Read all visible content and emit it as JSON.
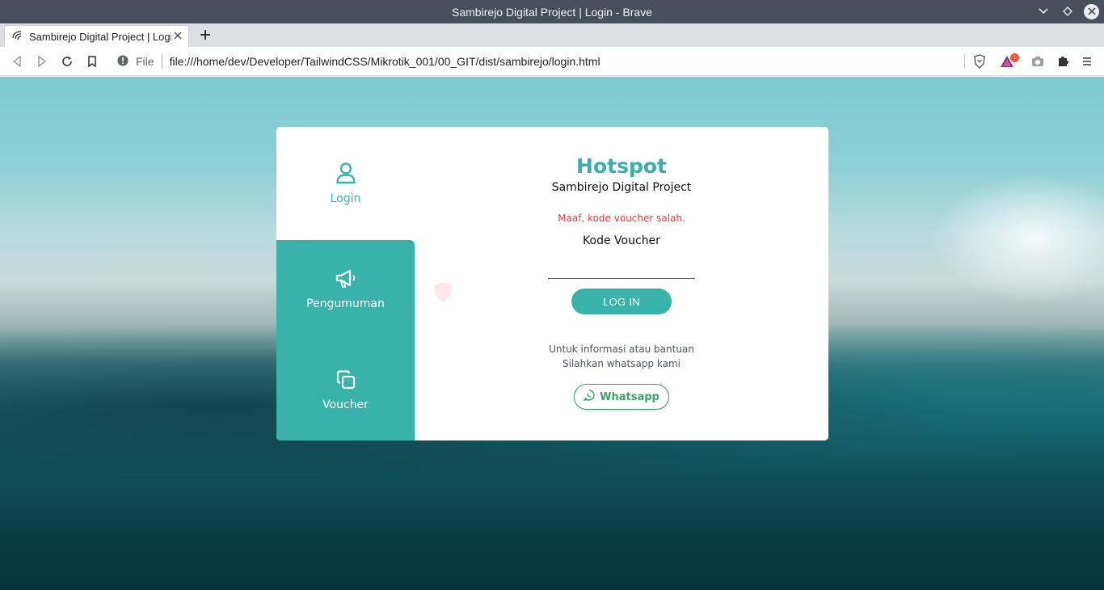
{
  "window": {
    "title": "Sambirejo Digital Project | Login - Brave"
  },
  "tab": {
    "title": "Sambirejo Digital Project | Login"
  },
  "addressbar": {
    "scheme_label": "File",
    "url": "file:///home/dev/Developer/TailwindCSS/Mikrotik_001/00_GIT/dist/sambirejo/login.html"
  },
  "extensions": {
    "rewards_badge": "1"
  },
  "sidebar": {
    "items": [
      {
        "label": "Login",
        "icon": "user-icon"
      },
      {
        "label": "Pengumuman",
        "icon": "megaphone-icon"
      },
      {
        "label": "Voucher",
        "icon": "copy-icon"
      }
    ]
  },
  "login": {
    "title": "Hotspot",
    "subtitle": "Sambirejo Digital Project",
    "error": "Maaf, kode voucher salah.",
    "voucher_label": "Kode Voucher",
    "voucher_value": "",
    "submit_label": "LOG IN",
    "info_line1": "Untuk informasi atau bantuan",
    "info_line2": "Silahkan whatsapp kami",
    "whatsapp_label": "Whatsapp"
  },
  "colors": {
    "accent": "#38b2ab",
    "error": "#e53e3e",
    "whatsapp": "#38a169"
  }
}
